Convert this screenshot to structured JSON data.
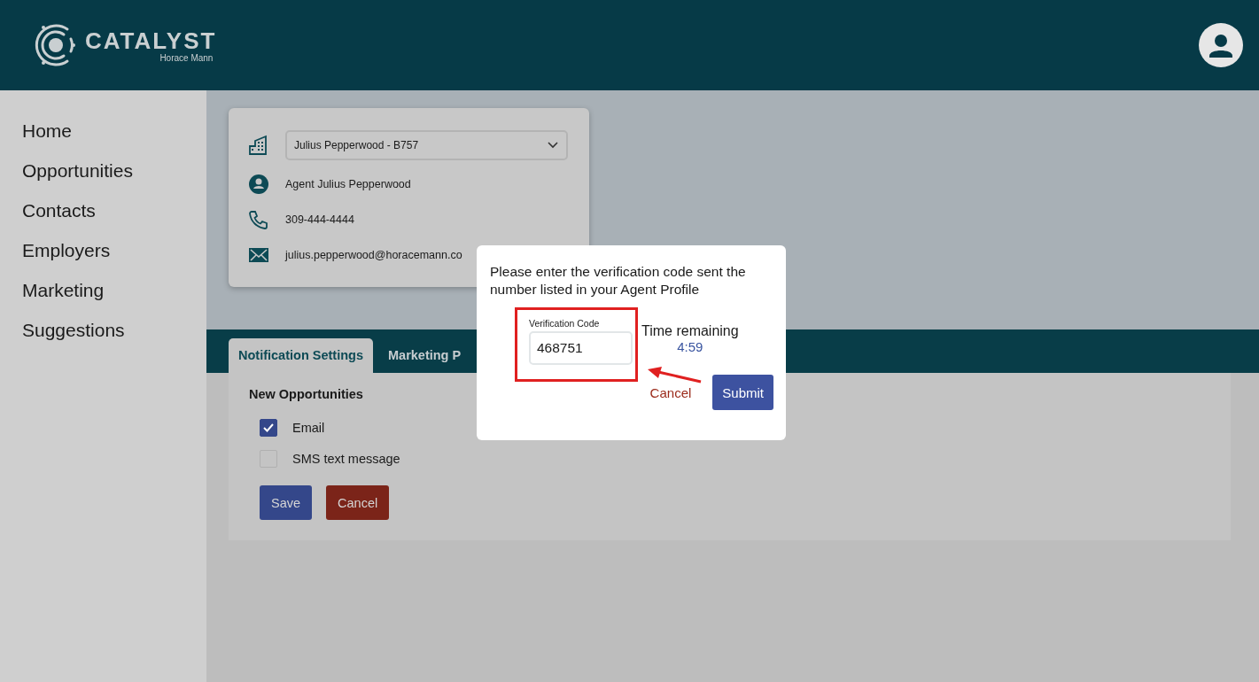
{
  "header": {
    "logo_title": "CATALYST",
    "logo_subtitle": "Horace Mann"
  },
  "sidebar": {
    "items": [
      {
        "label": "Home"
      },
      {
        "label": "Opportunities"
      },
      {
        "label": "Contacts"
      },
      {
        "label": "Employers"
      },
      {
        "label": "Marketing"
      },
      {
        "label": "Suggestions"
      }
    ]
  },
  "agent_card": {
    "office_select": "Julius Pepperwood - B757",
    "agent_name": "Agent Julius Pepperwood",
    "phone": "309-444-4444",
    "email": "julius.pepperwood@horacemann.co"
  },
  "tabs": [
    {
      "label": "Notification Settings",
      "selected": true
    },
    {
      "label": "Marketing P",
      "selected": false
    }
  ],
  "notification_settings": {
    "heading": "New Opportunities",
    "options": [
      {
        "label": "Email",
        "checked": true
      },
      {
        "label": "SMS text message",
        "checked": false
      }
    ],
    "save": "Save",
    "cancel": "Cancel"
  },
  "dialog": {
    "message": "Please enter the verification code sent the number listed in your Agent Profile",
    "field_label": "Verification Code",
    "field_value": "468751",
    "timer_label": "Time remaining",
    "timer_value": "4:59",
    "cancel": "Cancel",
    "submit": "Submit"
  }
}
